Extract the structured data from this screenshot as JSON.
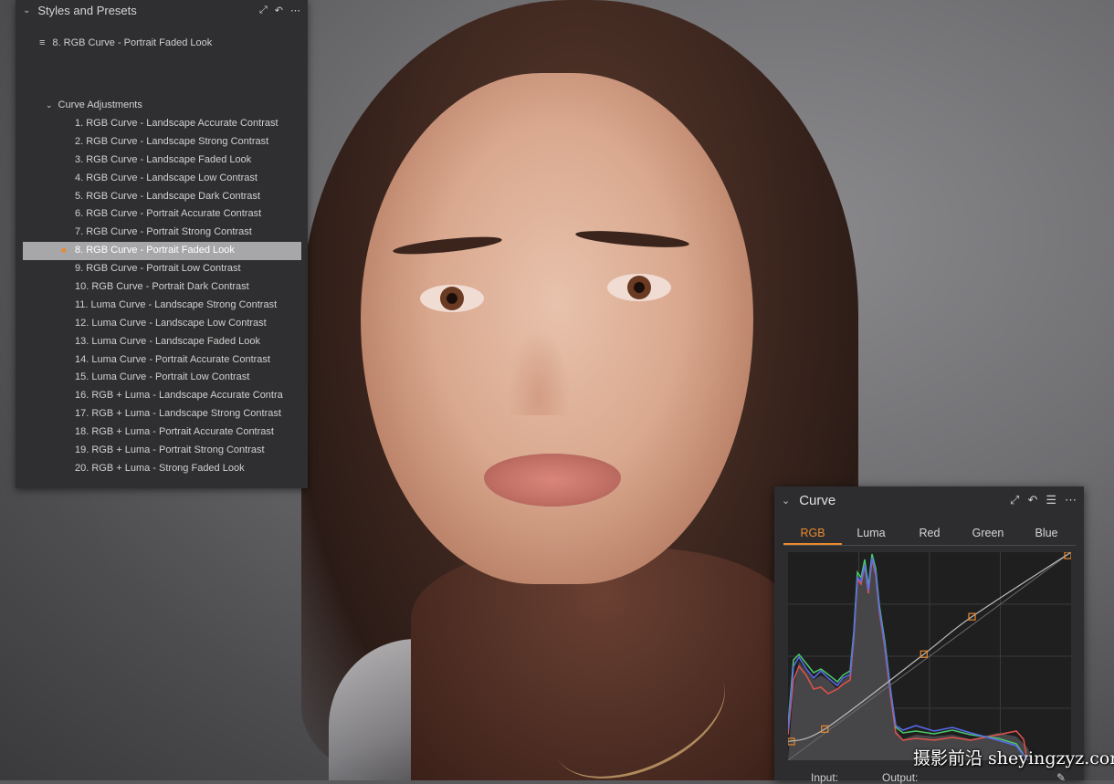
{
  "presets_panel": {
    "title": "Styles and Presets",
    "current_style": "8. RGB Curve - Portrait Faded Look",
    "group_title": "Curve Adjustments",
    "items": [
      "1. RGB Curve - Landscape Accurate Contrast",
      "2. RGB Curve - Landscape Strong Contrast",
      "3. RGB Curve - Landscape Faded Look",
      "4. RGB Curve - Landscape Low Contrast",
      "5. RGB Curve - Landscape Dark Contrast",
      "6. RGB Curve - Portrait Accurate Contrast",
      "7. RGB Curve - Portrait Strong Contrast",
      "8. RGB Curve - Portrait Faded Look",
      "9. RGB Curve - Portrait Low Contrast",
      "10. RGB Curve - Portrait Dark Contrast",
      "11. Luma Curve - Landscape Strong Contrast",
      "12. Luma Curve - Landscape Low Contrast",
      "13. Luma Curve - Landscape Faded Look",
      "14. Luma Curve - Portrait Accurate Contrast",
      "15. Luma Curve - Portrait Low Contrast",
      "16. RGB + Luma - Landscape Accurate Contra",
      "17. RGB + Luma - Landscape Strong Contrast",
      "18. RGB + Luma - Portrait Accurate Contrast",
      "19. RGB + Luma - Portrait Strong Contrast",
      "20. RGB + Luma - Strong Faded Look"
    ],
    "selected_index": 7
  },
  "curve_panel": {
    "title": "Curve",
    "tabs": [
      "RGB",
      "Luma",
      "Red",
      "Green",
      "Blue"
    ],
    "active_tab": 0,
    "input_label": "Input:",
    "output_label": "Output:",
    "curve_points": [
      [
        0.0,
        0.09
      ],
      [
        0.13,
        0.15
      ],
      [
        0.48,
        0.51
      ],
      [
        0.65,
        0.69
      ],
      [
        1.0,
        1.0
      ]
    ]
  },
  "colors": {
    "accent": "#e98a2d",
    "panel_bg": "#2f2f31",
    "selected_row": "#a7a7a9"
  },
  "watermark": "摄影前沿 sheyingzyz.com"
}
